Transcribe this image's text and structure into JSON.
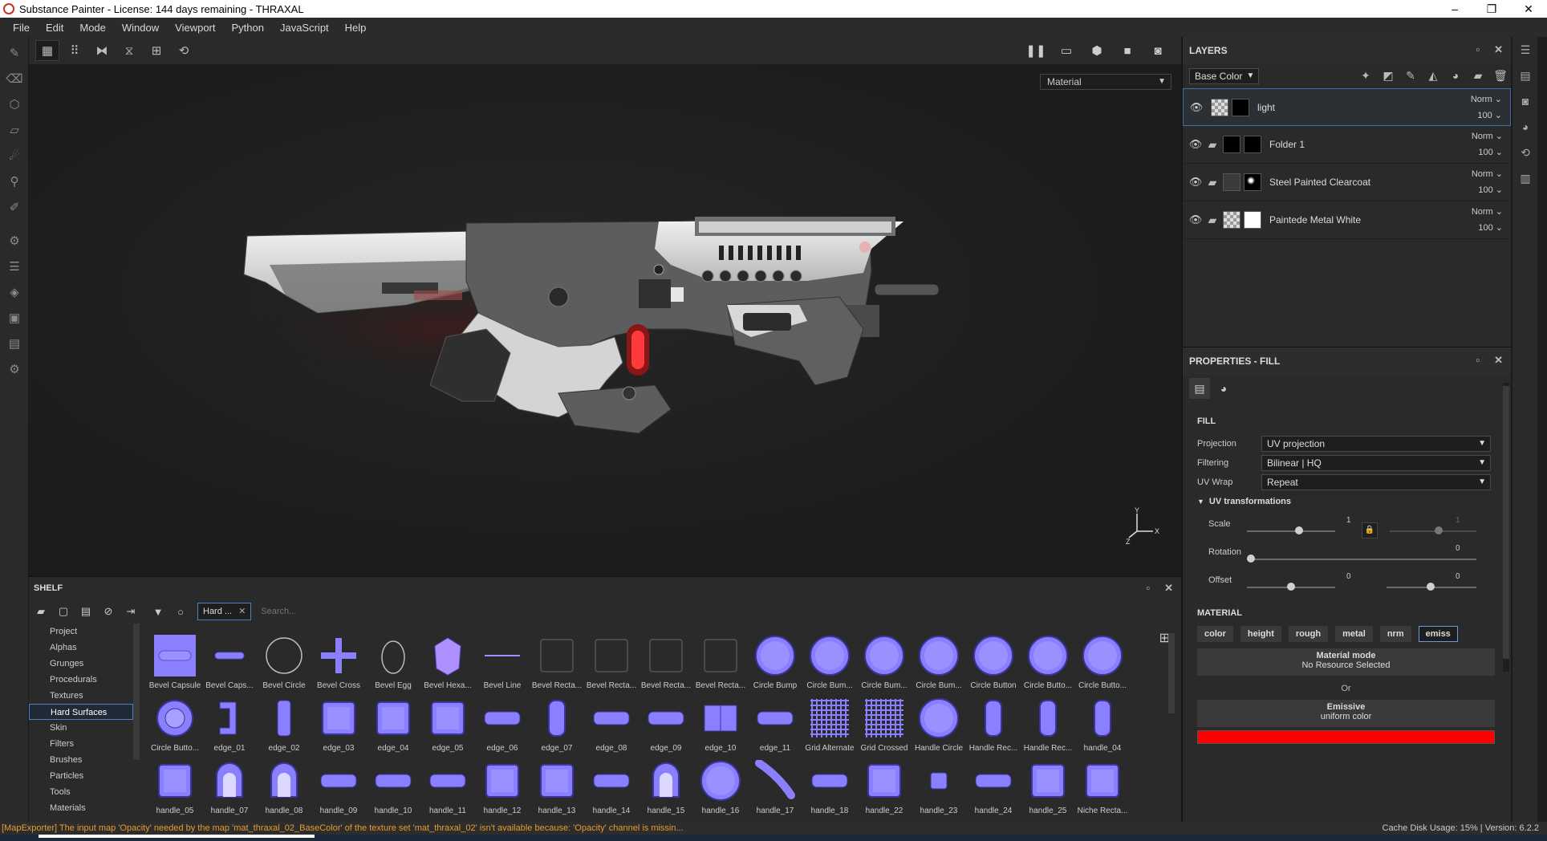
{
  "window": {
    "title": "Substance Painter - License: 144 days remaining - THRAXAL",
    "minimize": "–",
    "maximize": "❐",
    "close": "✕"
  },
  "menu": [
    "File",
    "Edit",
    "Mode",
    "Window",
    "Viewport",
    "Python",
    "JavaScript",
    "Help"
  ],
  "viewport": {
    "mode_select": "Material",
    "axis_labels": {
      "y": "Y",
      "z": "Z",
      "x": "X"
    }
  },
  "layers": {
    "title": "LAYERS",
    "channel": "Base Color",
    "items": [
      {
        "name": "light",
        "blend": "Norm",
        "opacity": "100",
        "selected": true
      },
      {
        "name": "Folder 1",
        "blend": "Norm",
        "opacity": "100",
        "selected": false
      },
      {
        "name": "Steel Painted Clearcoat",
        "blend": "Norm",
        "opacity": "100",
        "selected": false
      },
      {
        "name": "Paintede Metal White",
        "blend": "Norm",
        "opacity": "100",
        "selected": false
      }
    ]
  },
  "properties": {
    "title": "PROPERTIES - FILL",
    "fill_title": "FILL",
    "projection_label": "Projection",
    "projection_value": "UV projection",
    "filtering_label": "Filtering",
    "filtering_value": "Bilinear | HQ",
    "uvwrap_label": "UV Wrap",
    "uvwrap_value": "Repeat",
    "uv_transformations": "UV transformations",
    "scale_label": "Scale",
    "scale_value": "1",
    "scale_value_2": "1",
    "rotation_label": "Rotation",
    "rotation_value": "0",
    "offset_label": "Offset",
    "offset_value_1": "0",
    "offset_value_2": "0",
    "material_title": "MATERIAL",
    "channels": [
      "color",
      "height",
      "rough",
      "metal",
      "nrm",
      "emiss"
    ],
    "material_mode_title": "Material mode",
    "material_mode_sub": "No Resource Selected",
    "or_text": "Or",
    "emissive_title": "Emissive",
    "emissive_sub": "uniform color",
    "emissive_color": "#ff0000"
  },
  "shelf": {
    "title": "SHELF",
    "filter_tag": "Hard ...",
    "search_placeholder": "Search...",
    "categories": [
      "Project",
      "Alphas",
      "Grunges",
      "Procedurals",
      "Textures",
      "Hard Surfaces",
      "Skin",
      "Filters",
      "Brushes",
      "Particles",
      "Tools",
      "Materials"
    ],
    "selected_category": "Hard Surfaces",
    "items": [
      "Bevel Capsule",
      "Bevel Caps...",
      "Bevel Circle",
      "Bevel Cross",
      "Bevel Egg",
      "Bevel Hexa...",
      "Bevel Line",
      "Bevel Recta...",
      "Bevel Recta...",
      "Bevel Recta...",
      "Bevel Recta...",
      "Circle Bump",
      "Circle Bum...",
      "Circle Bum...",
      "Circle Bum...",
      "Circle Button",
      "Circle Butto...",
      "Circle Butto...",
      "Circle Butto...",
      "edge_01",
      "edge_02",
      "edge_03",
      "edge_04",
      "edge_05",
      "edge_06",
      "edge_07",
      "edge_08",
      "edge_09",
      "edge_10",
      "edge_11",
      "Grid Alternate",
      "Grid Crossed",
      "Handle Circle",
      "Handle Rec...",
      "Handle Rec...",
      "handle_04",
      "handle_05",
      "handle_07",
      "handle_08",
      "handle_09",
      "handle_10",
      "handle_11",
      "handle_12",
      "handle_13",
      "handle_14",
      "handle_15",
      "handle_16",
      "handle_17",
      "handle_18",
      "handle_22",
      "handle_23",
      "handle_24",
      "handle_25",
      "Niche Recta..."
    ]
  },
  "status": {
    "message": "[MapExporter] The input map 'Opacity' needed by the map 'mat_thraxal_02_BaseColor' of the texture set 'mat_thraxal_02' isn't available because: 'Opacity' channel is missin...",
    "cache": "Cache Disk Usage:   15% | Version: 6.2.2"
  }
}
